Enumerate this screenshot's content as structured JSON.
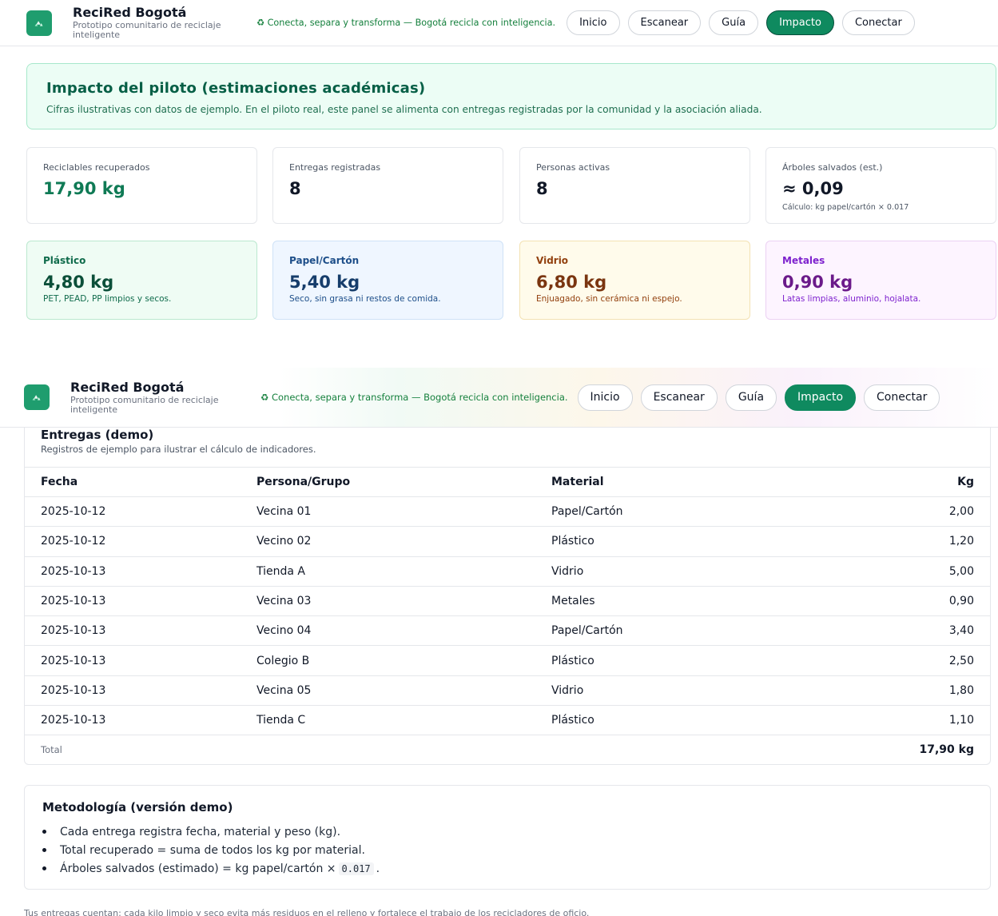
{
  "header": {
    "title": "ReciRed Bogotá",
    "subtitle": "Prototipo comunitario de reciclaje inteligente",
    "tagline": "♻ Conecta, separa y transforma — Bogotá recicla con inteligencia.",
    "nav": [
      "Inicio",
      "Escanear",
      "Guía",
      "Impacto",
      "Conectar"
    ],
    "active_nav": "Impacto"
  },
  "banner": {
    "title": "Impacto del piloto (estimaciones académicas)",
    "text": "Cifras ilustrativas con datos de ejemplo. En el piloto real, este panel se alimenta con entregas registradas por la comunidad y la asociación aliada."
  },
  "stats": [
    {
      "label": "Reciclables recuperados",
      "value": "17,90 kg",
      "note": ""
    },
    {
      "label": "Entregas registradas",
      "value": "8",
      "note": ""
    },
    {
      "label": "Personas activas",
      "value": "8",
      "note": ""
    },
    {
      "label": "Árboles salvados (est.)",
      "value": "≈ 0,09",
      "note": "Cálculo: kg papel/cartón × 0.017"
    }
  ],
  "materials": [
    {
      "name": "Plástico",
      "value": "4,80 kg",
      "desc": "PET, PEAD, PP limpios y secos."
    },
    {
      "name": "Papel/Cartón",
      "value": "5,40 kg",
      "desc": "Seco, sin grasa ni restos de comida."
    },
    {
      "name": "Vidrio",
      "value": "6,80 kg",
      "desc": "Enjuagado, sin cerámica ni espejo."
    },
    {
      "name": "Metales",
      "value": "0,90 kg",
      "desc": "Latas limpias, aluminio, hojalata."
    }
  ],
  "entries": {
    "title": "Entregas (demo)",
    "subtitle": "Registros de ejemplo para ilustrar el cálculo de indicadores.",
    "columns": [
      "Fecha",
      "Persona/Grupo",
      "Material",
      "Kg"
    ],
    "rows": [
      [
        "2025-10-12",
        "Vecina 01",
        "Papel/Cartón",
        "2,00"
      ],
      [
        "2025-10-12",
        "Vecino 02",
        "Plástico",
        "1,20"
      ],
      [
        "2025-10-13",
        "Tienda A",
        "Vidrio",
        "5,00"
      ],
      [
        "2025-10-13",
        "Vecina 03",
        "Metales",
        "0,90"
      ],
      [
        "2025-10-13",
        "Vecino 04",
        "Papel/Cartón",
        "3,40"
      ],
      [
        "2025-10-13",
        "Colegio B",
        "Plástico",
        "2,50"
      ],
      [
        "2025-10-13",
        "Vecina 05",
        "Vidrio",
        "1,80"
      ],
      [
        "2025-10-13",
        "Tienda C",
        "Plástico",
        "1,10"
      ]
    ],
    "total_label": "Total",
    "total_value": "17,90 kg"
  },
  "methodology": {
    "title": "Metodología (versión demo)",
    "items": [
      "Cada entrega registra fecha, material y peso (kg).",
      "Total recuperado = suma de todos los kg por material."
    ],
    "item3_prefix": "Árboles salvados (estimado) = kg papel/cartón ×",
    "item3_code": "0.017",
    "item3_suffix": "."
  },
  "footer_note": "Tus entregas cuentan: cada kilo limpio y seco evita más residuos en el relleno y fortalece el trabajo de los recicladores de oficio."
}
